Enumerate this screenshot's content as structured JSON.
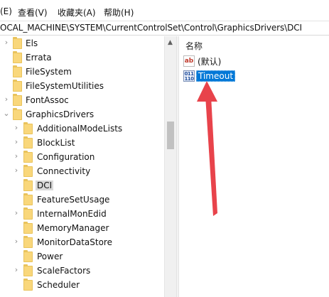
{
  "menu": {
    "items": [
      "(E)",
      "查看(V)",
      "收藏夹(A)",
      "帮助(H)"
    ]
  },
  "address": {
    "path": "OCAL_MACHINE\\SYSTEM\\CurrentControlSet\\Control\\GraphicsDrivers\\DCI"
  },
  "tree": {
    "items": [
      {
        "label": "Els",
        "level": 1,
        "expander": "collapsed"
      },
      {
        "label": "Errata",
        "level": 1,
        "expander": "none"
      },
      {
        "label": "FileSystem",
        "level": 1,
        "expander": "none"
      },
      {
        "label": "FileSystemUtilities",
        "level": 1,
        "expander": "none"
      },
      {
        "label": "FontAssoc",
        "level": 1,
        "expander": "collapsed"
      },
      {
        "label": "GraphicsDrivers",
        "level": 1,
        "expander": "expanded"
      },
      {
        "label": "AdditionalModeLists",
        "level": 2,
        "expander": "collapsed"
      },
      {
        "label": "BlockList",
        "level": 2,
        "expander": "collapsed"
      },
      {
        "label": "Configuration",
        "level": 2,
        "expander": "collapsed"
      },
      {
        "label": "Connectivity",
        "level": 2,
        "expander": "collapsed"
      },
      {
        "label": "DCI",
        "level": 2,
        "expander": "none",
        "selected": true
      },
      {
        "label": "FeatureSetUsage",
        "level": 2,
        "expander": "none"
      },
      {
        "label": "InternalMonEdid",
        "level": 2,
        "expander": "collapsed"
      },
      {
        "label": "MemoryManager",
        "level": 2,
        "expander": "none"
      },
      {
        "label": "MonitorDataStore",
        "level": 2,
        "expander": "collapsed"
      },
      {
        "label": "Power",
        "level": 2,
        "expander": "none"
      },
      {
        "label": "ScaleFactors",
        "level": 2,
        "expander": "collapsed"
      },
      {
        "label": "Scheduler",
        "level": 2,
        "expander": "none"
      }
    ]
  },
  "values": {
    "column_header": "名称",
    "rows": [
      {
        "name": "(默认)",
        "type_icon": "string-value-icon",
        "selected": false
      },
      {
        "name": "Timeout",
        "type_icon": "binary-value-icon",
        "selected": true
      }
    ]
  },
  "colors": {
    "selection_blue": "#0078d7",
    "annotation_red": "#e8434b",
    "folder_yellow": "#f9d77b"
  }
}
